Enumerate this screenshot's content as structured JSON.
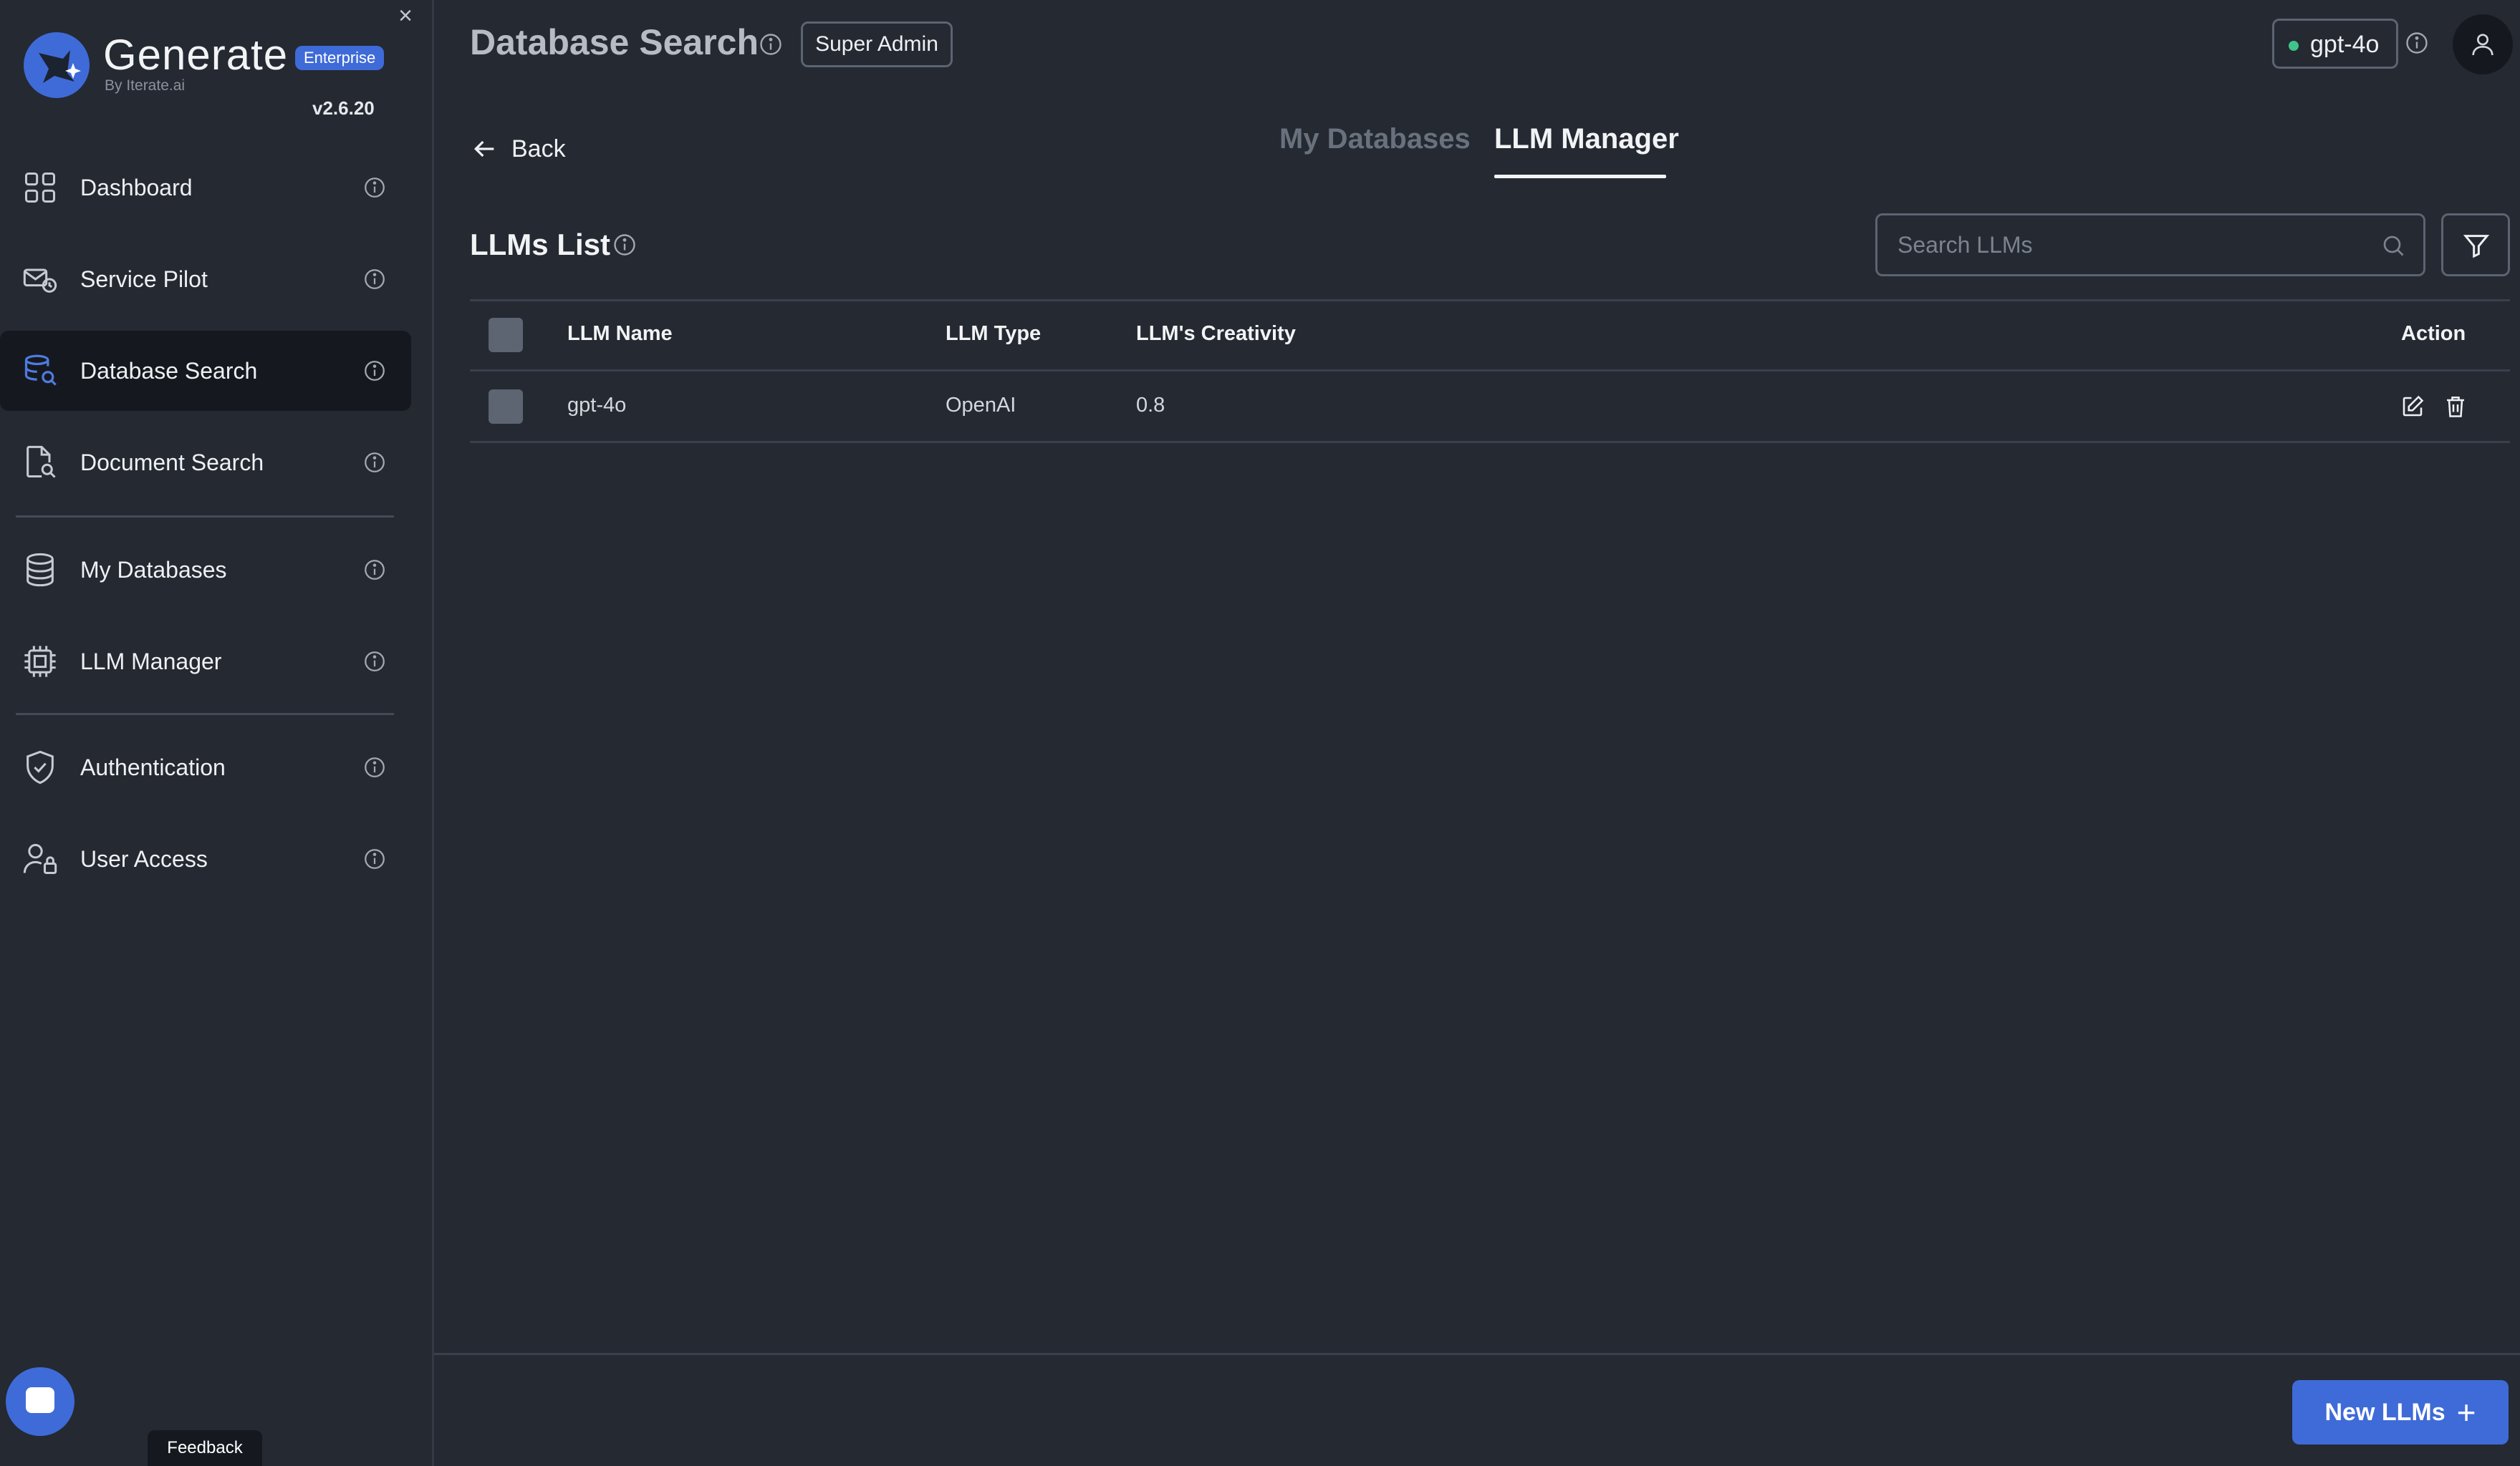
{
  "sidebar": {
    "brand": {
      "name": "Generate",
      "badge": "Enterprise",
      "by": "By Iterate.ai",
      "version": "v2.6.20"
    },
    "items": [
      {
        "label": "Dashboard",
        "icon": "grid-icon"
      },
      {
        "label": "Service Pilot",
        "icon": "service-pilot-icon"
      },
      {
        "label": "Database Search",
        "icon": "database-search-icon",
        "active": true
      },
      {
        "label": "Document Search",
        "icon": "document-search-icon"
      },
      {
        "label": "My Databases",
        "icon": "database-icon"
      },
      {
        "label": "LLM Manager",
        "icon": "chip-icon"
      },
      {
        "label": "Authentication",
        "icon": "shield-check-icon"
      },
      {
        "label": "User Access",
        "icon": "user-lock-icon"
      }
    ],
    "feedback_label": "Feedback"
  },
  "header": {
    "title": "Database Search",
    "role": "Super Admin",
    "model": "gpt-4o"
  },
  "main": {
    "back_label": "Back",
    "tabs": [
      {
        "label": "My Databases",
        "active": false
      },
      {
        "label": "LLM Manager",
        "active": true
      }
    ],
    "list_title": "LLMs List",
    "search": {
      "placeholder": "Search LLMs",
      "value": ""
    },
    "table": {
      "columns": [
        "LLM Name",
        "LLM Type",
        "LLM's Creativity",
        "Action"
      ],
      "rows": [
        {
          "name": "gpt-4o",
          "type": "OpenAI",
          "creativity": "0.8"
        }
      ]
    },
    "new_button_label": "New LLMs"
  },
  "colors": {
    "background": "#242932",
    "accent": "#3f6bd8",
    "active_nav": "#15191f",
    "status_dot": "#3fc48a"
  }
}
